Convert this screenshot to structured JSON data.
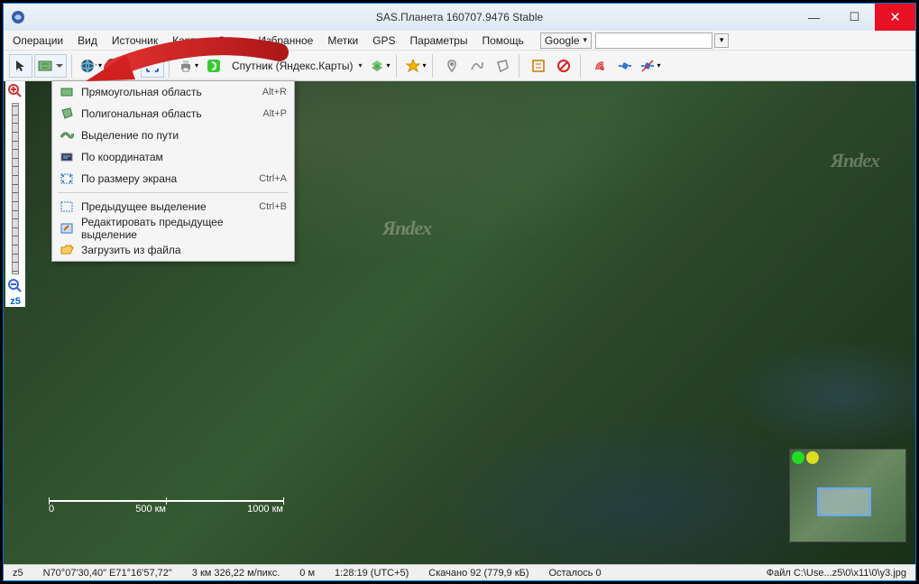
{
  "title": "SAS.Планета 160707.9476 Stable",
  "menu": {
    "items": [
      "Операции",
      "Вид",
      "Источник",
      "Карты",
      "Слои",
      "Избранное",
      "Метки",
      "GPS",
      "Параметры",
      "Помощь"
    ],
    "search_provider": "Google",
    "search_placeholder": ""
  },
  "toolbar": {
    "current_map": "Спутник (Яндекс.Карты)"
  },
  "dropdown": {
    "items": [
      {
        "label": "Прямоугольная область",
        "shortcut": "Alt+R",
        "icon": "rect"
      },
      {
        "label": "Полигональная область",
        "shortcut": "Alt+P",
        "icon": "poly"
      },
      {
        "label": "Выделение по пути",
        "shortcut": "",
        "icon": "path"
      },
      {
        "label": "По координатам",
        "shortcut": "",
        "icon": "coords"
      },
      {
        "label": "По размеру экрана",
        "shortcut": "Ctrl+A",
        "icon": "screen"
      }
    ],
    "items2": [
      {
        "label": "Предыдущее выделение",
        "shortcut": "Ctrl+B",
        "icon": "prev"
      },
      {
        "label": "Редактировать предыдущее выделение",
        "shortcut": "",
        "icon": "edit"
      },
      {
        "label": "Загрузить из файла",
        "shortcut": "",
        "icon": "load"
      }
    ]
  },
  "zoom": {
    "label": "z5"
  },
  "watermarks": [
    "Яndex",
    "Яndex"
  ],
  "scalebar": {
    "labels": [
      "0",
      "500 км",
      "1000 км"
    ]
  },
  "status": {
    "zoom": "z5",
    "coords": "N70°07'30,40\" E71°16'57,72\"",
    "resolution": "3 км 326,22 м/пикс.",
    "elevation": "0 м",
    "time": "1:28:19 (UTC+5)",
    "downloaded": "Скачано 92 (779,9 кБ)",
    "remaining": "Осталось 0",
    "file": "Файл C:\\Use...z5\\0\\x11\\0\\y3.jpg"
  },
  "colors": {
    "close": "#e81123",
    "accent": "#0078d7"
  }
}
